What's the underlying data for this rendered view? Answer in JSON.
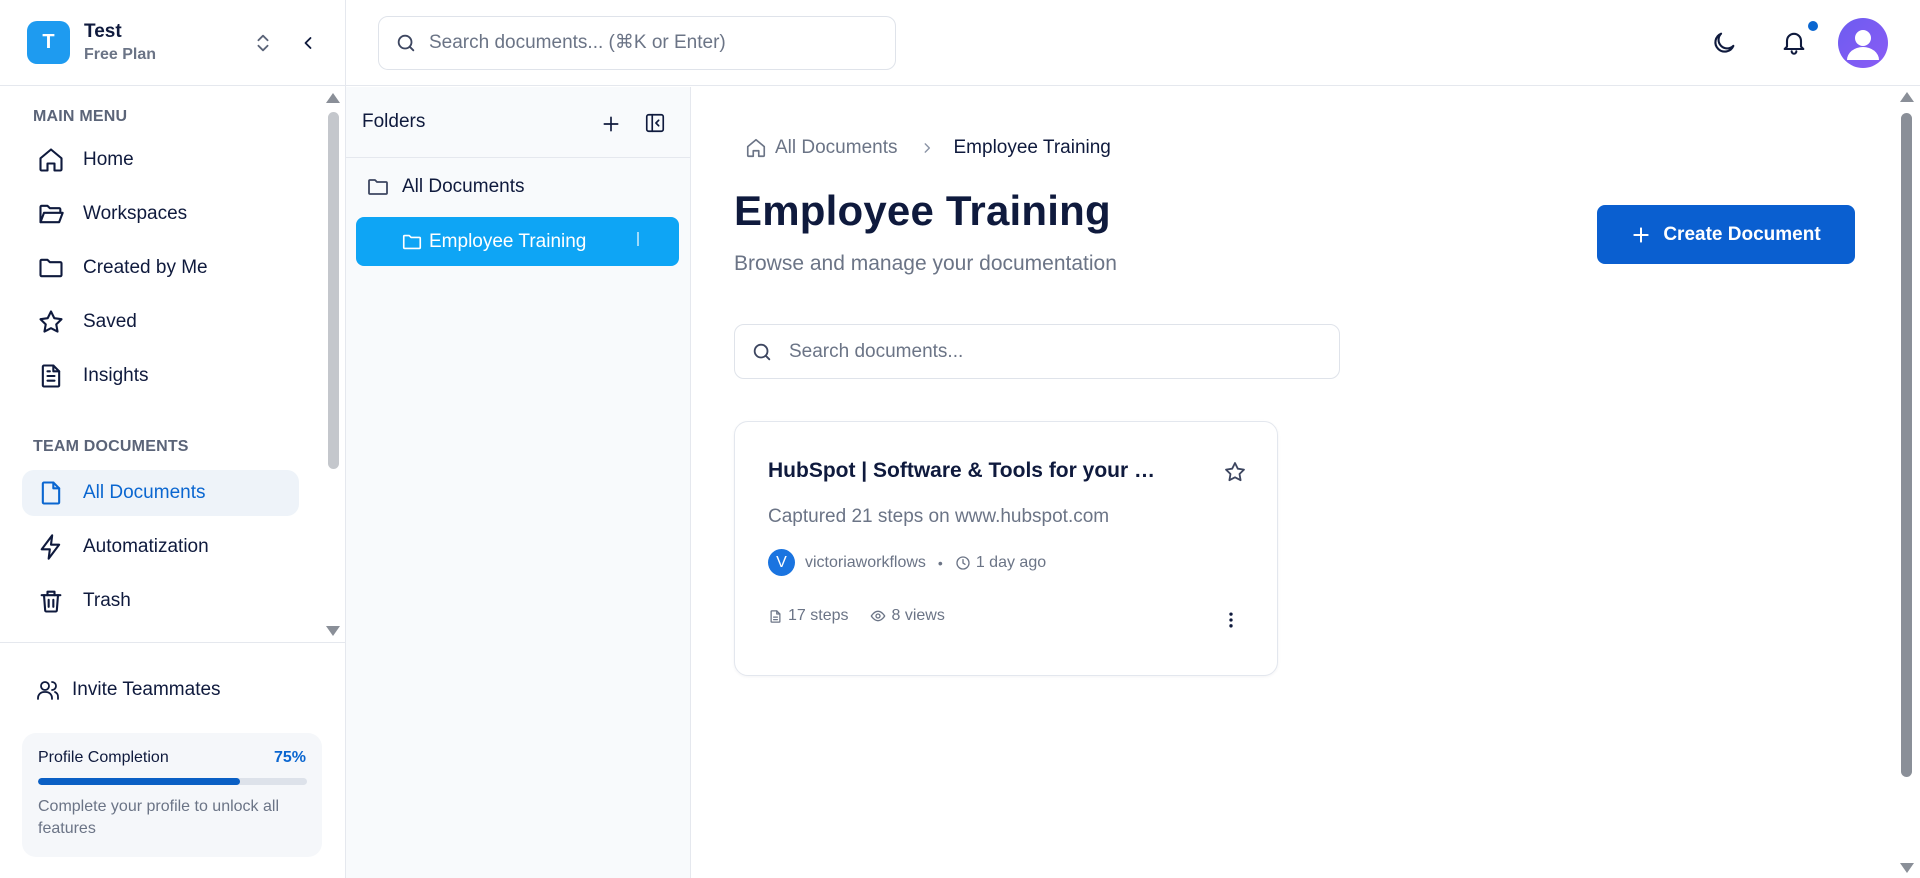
{
  "workspace": {
    "initial": "T",
    "name": "Test",
    "plan": "Free Plan"
  },
  "global_search": {
    "placeholder": "Search documents... (⌘K or Enter)"
  },
  "sidebar": {
    "main_menu_title": "MAIN MENU",
    "main_items": [
      {
        "label": "Home",
        "icon": "home-icon"
      },
      {
        "label": "Workspaces",
        "icon": "folder-open-icon"
      },
      {
        "label": "Created by Me",
        "icon": "folder-icon"
      },
      {
        "label": "Saved",
        "icon": "star-icon"
      },
      {
        "label": "Insights",
        "icon": "document-icon"
      }
    ],
    "team_title": "TEAM DOCUMENTS",
    "team_items": [
      {
        "label": "All Documents",
        "icon": "file-icon",
        "active": true
      },
      {
        "label": "Automatization",
        "icon": "lightning-icon"
      },
      {
        "label": "Trash",
        "icon": "trash-icon"
      }
    ],
    "invite_label": "Invite Teammates",
    "profile": {
      "title": "Profile Completion",
      "percent_label": "75%",
      "progress": 0.75,
      "description": "Complete your profile to unlock all features"
    }
  },
  "folders": {
    "title": "Folders",
    "items": [
      {
        "label": "All Documents"
      },
      {
        "label": "Employee Training",
        "active": true
      }
    ]
  },
  "breadcrumb": {
    "root": "All Documents",
    "current": "Employee Training"
  },
  "main": {
    "title": "Employee Training",
    "subtitle": "Browse and manage your documentation",
    "create_label": "Create Document",
    "search_placeholder": "Search documents..."
  },
  "documents": [
    {
      "title": "HubSpot | Software & Tools for your Business - Homepage",
      "description": "Captured 21 steps on www.hubspot.com",
      "author_initial": "V",
      "author": "victoriaworkflows",
      "time": "1 day ago",
      "steps": "17 steps",
      "views": "8 views"
    }
  ],
  "colors": {
    "accent": "#0a5fd0",
    "active_folder": "#0ea5f5",
    "notification_dot": "#0a66d0"
  }
}
